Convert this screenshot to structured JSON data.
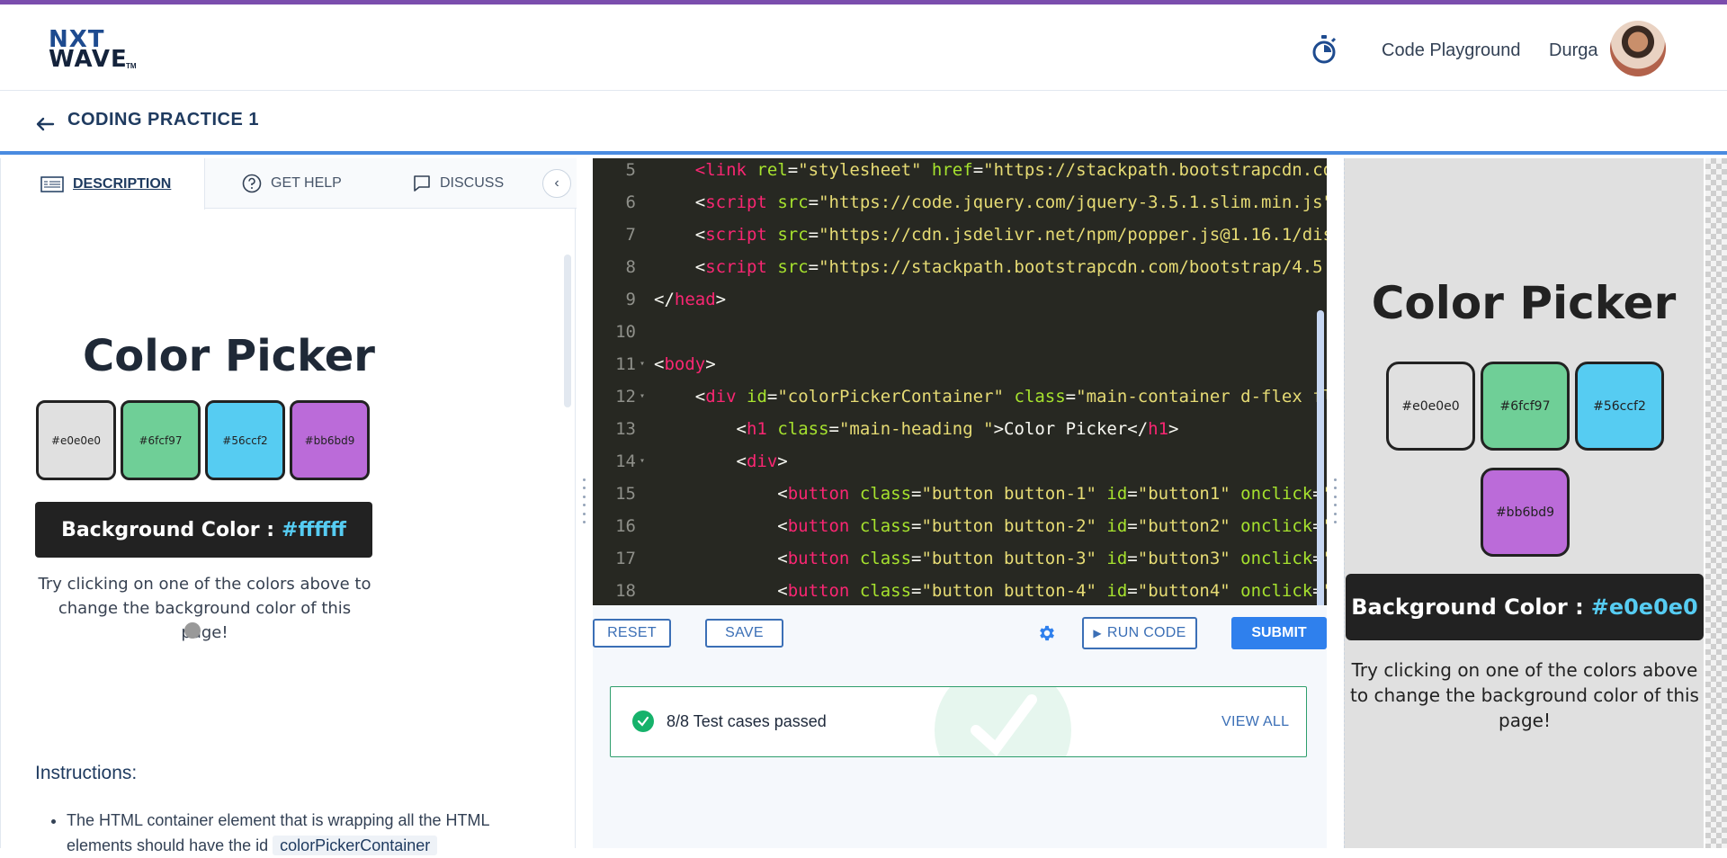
{
  "header": {
    "logo_line1": "NXT",
    "logo_line2": "WAVE",
    "logo_tm": "TM",
    "nav_playground": "Code Playground",
    "user_name": "Durga"
  },
  "subheader": {
    "title": "CODING PRACTICE 1"
  },
  "left_tabs": [
    {
      "label": "DESCRIPTION",
      "icon": "description-icon"
    },
    {
      "label": "GET HELP",
      "icon": "help-circle-icon"
    },
    {
      "label": "DISCUSS",
      "icon": "chat-icon"
    }
  ],
  "description_preview": {
    "title": "Color Picker",
    "swatches": [
      {
        "label": "#e0e0e0",
        "color": "#e0e0e0"
      },
      {
        "label": "#6fcf97",
        "color": "#6fcf97"
      },
      {
        "label": "#56ccf2",
        "color": "#56ccf2"
      },
      {
        "label": "#bb6bd9",
        "color": "#bb6bd9"
      }
    ],
    "bar_label": "Background Color :",
    "bar_value": "#ffffff",
    "text": "Try clicking on one of the colors above to change the background color of this page!"
  },
  "instructions": {
    "heading": "Instructions:",
    "item1_text": "The HTML container element that is wrapping all the HTML elements should have the id",
    "item1_code": "colorPickerContainer"
  },
  "editor": {
    "lines": [
      {
        "n": "5",
        "fold": "",
        "indent": "    ",
        "parts": [
          [
            "tag",
            "<link "
          ],
          [
            "attr",
            "rel"
          ],
          [
            "txt",
            "="
          ],
          [
            "str",
            "\"stylesheet\""
          ],
          [
            "txt",
            " "
          ],
          [
            "attr",
            "href"
          ],
          [
            "txt",
            "="
          ],
          [
            "str",
            "\"https://stackpath.bootstrapcdn.co"
          ]
        ]
      },
      {
        "n": "6",
        "fold": "",
        "indent": "    ",
        "parts": [
          [
            "txt",
            "<"
          ],
          [
            "tag",
            "script"
          ],
          [
            "txt",
            " "
          ],
          [
            "attr",
            "src"
          ],
          [
            "txt",
            "="
          ],
          [
            "str",
            "\"https://code.jquery.com/jquery-3.5.1.slim.min.js\""
          ]
        ]
      },
      {
        "n": "7",
        "fold": "",
        "indent": "    ",
        "parts": [
          [
            "txt",
            "<"
          ],
          [
            "tag",
            "script"
          ],
          [
            "txt",
            " "
          ],
          [
            "attr",
            "src"
          ],
          [
            "txt",
            "="
          ],
          [
            "str",
            "\"https://cdn.jsdelivr.net/npm/popper.js@1.16.1/dis"
          ]
        ]
      },
      {
        "n": "8",
        "fold": "",
        "indent": "    ",
        "parts": [
          [
            "txt",
            "<"
          ],
          [
            "tag",
            "script"
          ],
          [
            "txt",
            " "
          ],
          [
            "attr",
            "src"
          ],
          [
            "txt",
            "="
          ],
          [
            "str",
            "\"https://stackpath.bootstrapcdn.com/bootstrap/4.5."
          ]
        ]
      },
      {
        "n": "9",
        "fold": "",
        "indent": "",
        "parts": [
          [
            "txt",
            "</"
          ],
          [
            "tag",
            "head"
          ],
          [
            "txt",
            ">"
          ]
        ]
      },
      {
        "n": "10",
        "fold": "",
        "indent": "",
        "parts": []
      },
      {
        "n": "11",
        "fold": "▾",
        "indent": "",
        "parts": [
          [
            "txt",
            "<"
          ],
          [
            "tag",
            "body"
          ],
          [
            "txt",
            ">"
          ]
        ]
      },
      {
        "n": "12",
        "fold": "▾",
        "indent": "    ",
        "parts": [
          [
            "txt",
            "<"
          ],
          [
            "tag",
            "div"
          ],
          [
            "txt",
            " "
          ],
          [
            "attr",
            "id"
          ],
          [
            "txt",
            "="
          ],
          [
            "str",
            "\"colorPickerContainer\""
          ],
          [
            "txt",
            " "
          ],
          [
            "attr",
            "class"
          ],
          [
            "txt",
            "="
          ],
          [
            "str",
            "\"main-container d-flex fl"
          ]
        ]
      },
      {
        "n": "13",
        "fold": "",
        "indent": "        ",
        "parts": [
          [
            "txt",
            "<"
          ],
          [
            "tag",
            "h1"
          ],
          [
            "txt",
            " "
          ],
          [
            "attr",
            "class"
          ],
          [
            "txt",
            "="
          ],
          [
            "str",
            "\"main-heading \""
          ],
          [
            "txt",
            ">Color Picker</"
          ],
          [
            "tag",
            "h1"
          ],
          [
            "txt",
            ">"
          ]
        ]
      },
      {
        "n": "14",
        "fold": "▾",
        "indent": "        ",
        "parts": [
          [
            "txt",
            "<"
          ],
          [
            "tag",
            "div"
          ],
          [
            "txt",
            ">"
          ]
        ]
      },
      {
        "n": "15",
        "fold": "",
        "indent": "            ",
        "parts": [
          [
            "txt",
            "<"
          ],
          [
            "tag",
            "button"
          ],
          [
            "txt",
            " "
          ],
          [
            "attr",
            "class"
          ],
          [
            "txt",
            "="
          ],
          [
            "str",
            "\"button button-1\""
          ],
          [
            "txt",
            " "
          ],
          [
            "attr",
            "id"
          ],
          [
            "txt",
            "="
          ],
          [
            "str",
            "\"button1\""
          ],
          [
            "txt",
            " "
          ],
          [
            "attr",
            "onclick"
          ],
          [
            "txt",
            "="
          ],
          [
            "str",
            "\""
          ]
        ]
      },
      {
        "n": "16",
        "fold": "",
        "indent": "            ",
        "parts": [
          [
            "txt",
            "<"
          ],
          [
            "tag",
            "button"
          ],
          [
            "txt",
            " "
          ],
          [
            "attr",
            "class"
          ],
          [
            "txt",
            "="
          ],
          [
            "str",
            "\"button button-2\""
          ],
          [
            "txt",
            " "
          ],
          [
            "attr",
            "id"
          ],
          [
            "txt",
            "="
          ],
          [
            "str",
            "\"button2\""
          ],
          [
            "txt",
            " "
          ],
          [
            "attr",
            "onclick"
          ],
          [
            "txt",
            "="
          ],
          [
            "str",
            "\""
          ]
        ]
      },
      {
        "n": "17",
        "fold": "",
        "indent": "            ",
        "parts": [
          [
            "txt",
            "<"
          ],
          [
            "tag",
            "button"
          ],
          [
            "txt",
            " "
          ],
          [
            "attr",
            "class"
          ],
          [
            "txt",
            "="
          ],
          [
            "str",
            "\"button button-3\""
          ],
          [
            "txt",
            " "
          ],
          [
            "attr",
            "id"
          ],
          [
            "txt",
            "="
          ],
          [
            "str",
            "\"button3\""
          ],
          [
            "txt",
            " "
          ],
          [
            "attr",
            "onclick"
          ],
          [
            "txt",
            "="
          ],
          [
            "str",
            "\""
          ]
        ]
      },
      {
        "n": "18",
        "fold": "",
        "indent": "            ",
        "parts": [
          [
            "txt",
            "<"
          ],
          [
            "tag",
            "button"
          ],
          [
            "txt",
            " "
          ],
          [
            "attr",
            "class"
          ],
          [
            "txt",
            "="
          ],
          [
            "str",
            "\"button button-4\""
          ],
          [
            "txt",
            " "
          ],
          [
            "attr",
            "id"
          ],
          [
            "txt",
            "="
          ],
          [
            "str",
            "\"button4\""
          ],
          [
            "txt",
            " "
          ],
          [
            "attr",
            "onclick"
          ],
          [
            "txt",
            "="
          ],
          [
            "str",
            "\""
          ]
        ]
      }
    ]
  },
  "toolbar": {
    "reset": "RESET",
    "save": "SAVE",
    "run": "RUN CODE",
    "submit": "SUBMIT"
  },
  "results": {
    "status": "8/8 Test cases passed",
    "view_all": "VIEW ALL"
  },
  "preview": {
    "title": "Color Picker",
    "swatches": [
      {
        "label": "#e0e0e0",
        "color": "#e0e0e0"
      },
      {
        "label": "#6fcf97",
        "color": "#6fcf97"
      },
      {
        "label": "#56ccf2",
        "color": "#56ccf2"
      },
      {
        "label": "#bb6bd9",
        "color": "#bb6bd9"
      }
    ],
    "bar_label": "Background Color :",
    "bar_value": "#e0e0e0",
    "text": "Try clicking on one of the colors above to change the background color of this page!",
    "background": "#e0e0e0"
  },
  "colors": {
    "accent": "#7b4dad",
    "primary": "#2f80ed",
    "success": "#16b26b",
    "editor_bg": "#272822"
  }
}
